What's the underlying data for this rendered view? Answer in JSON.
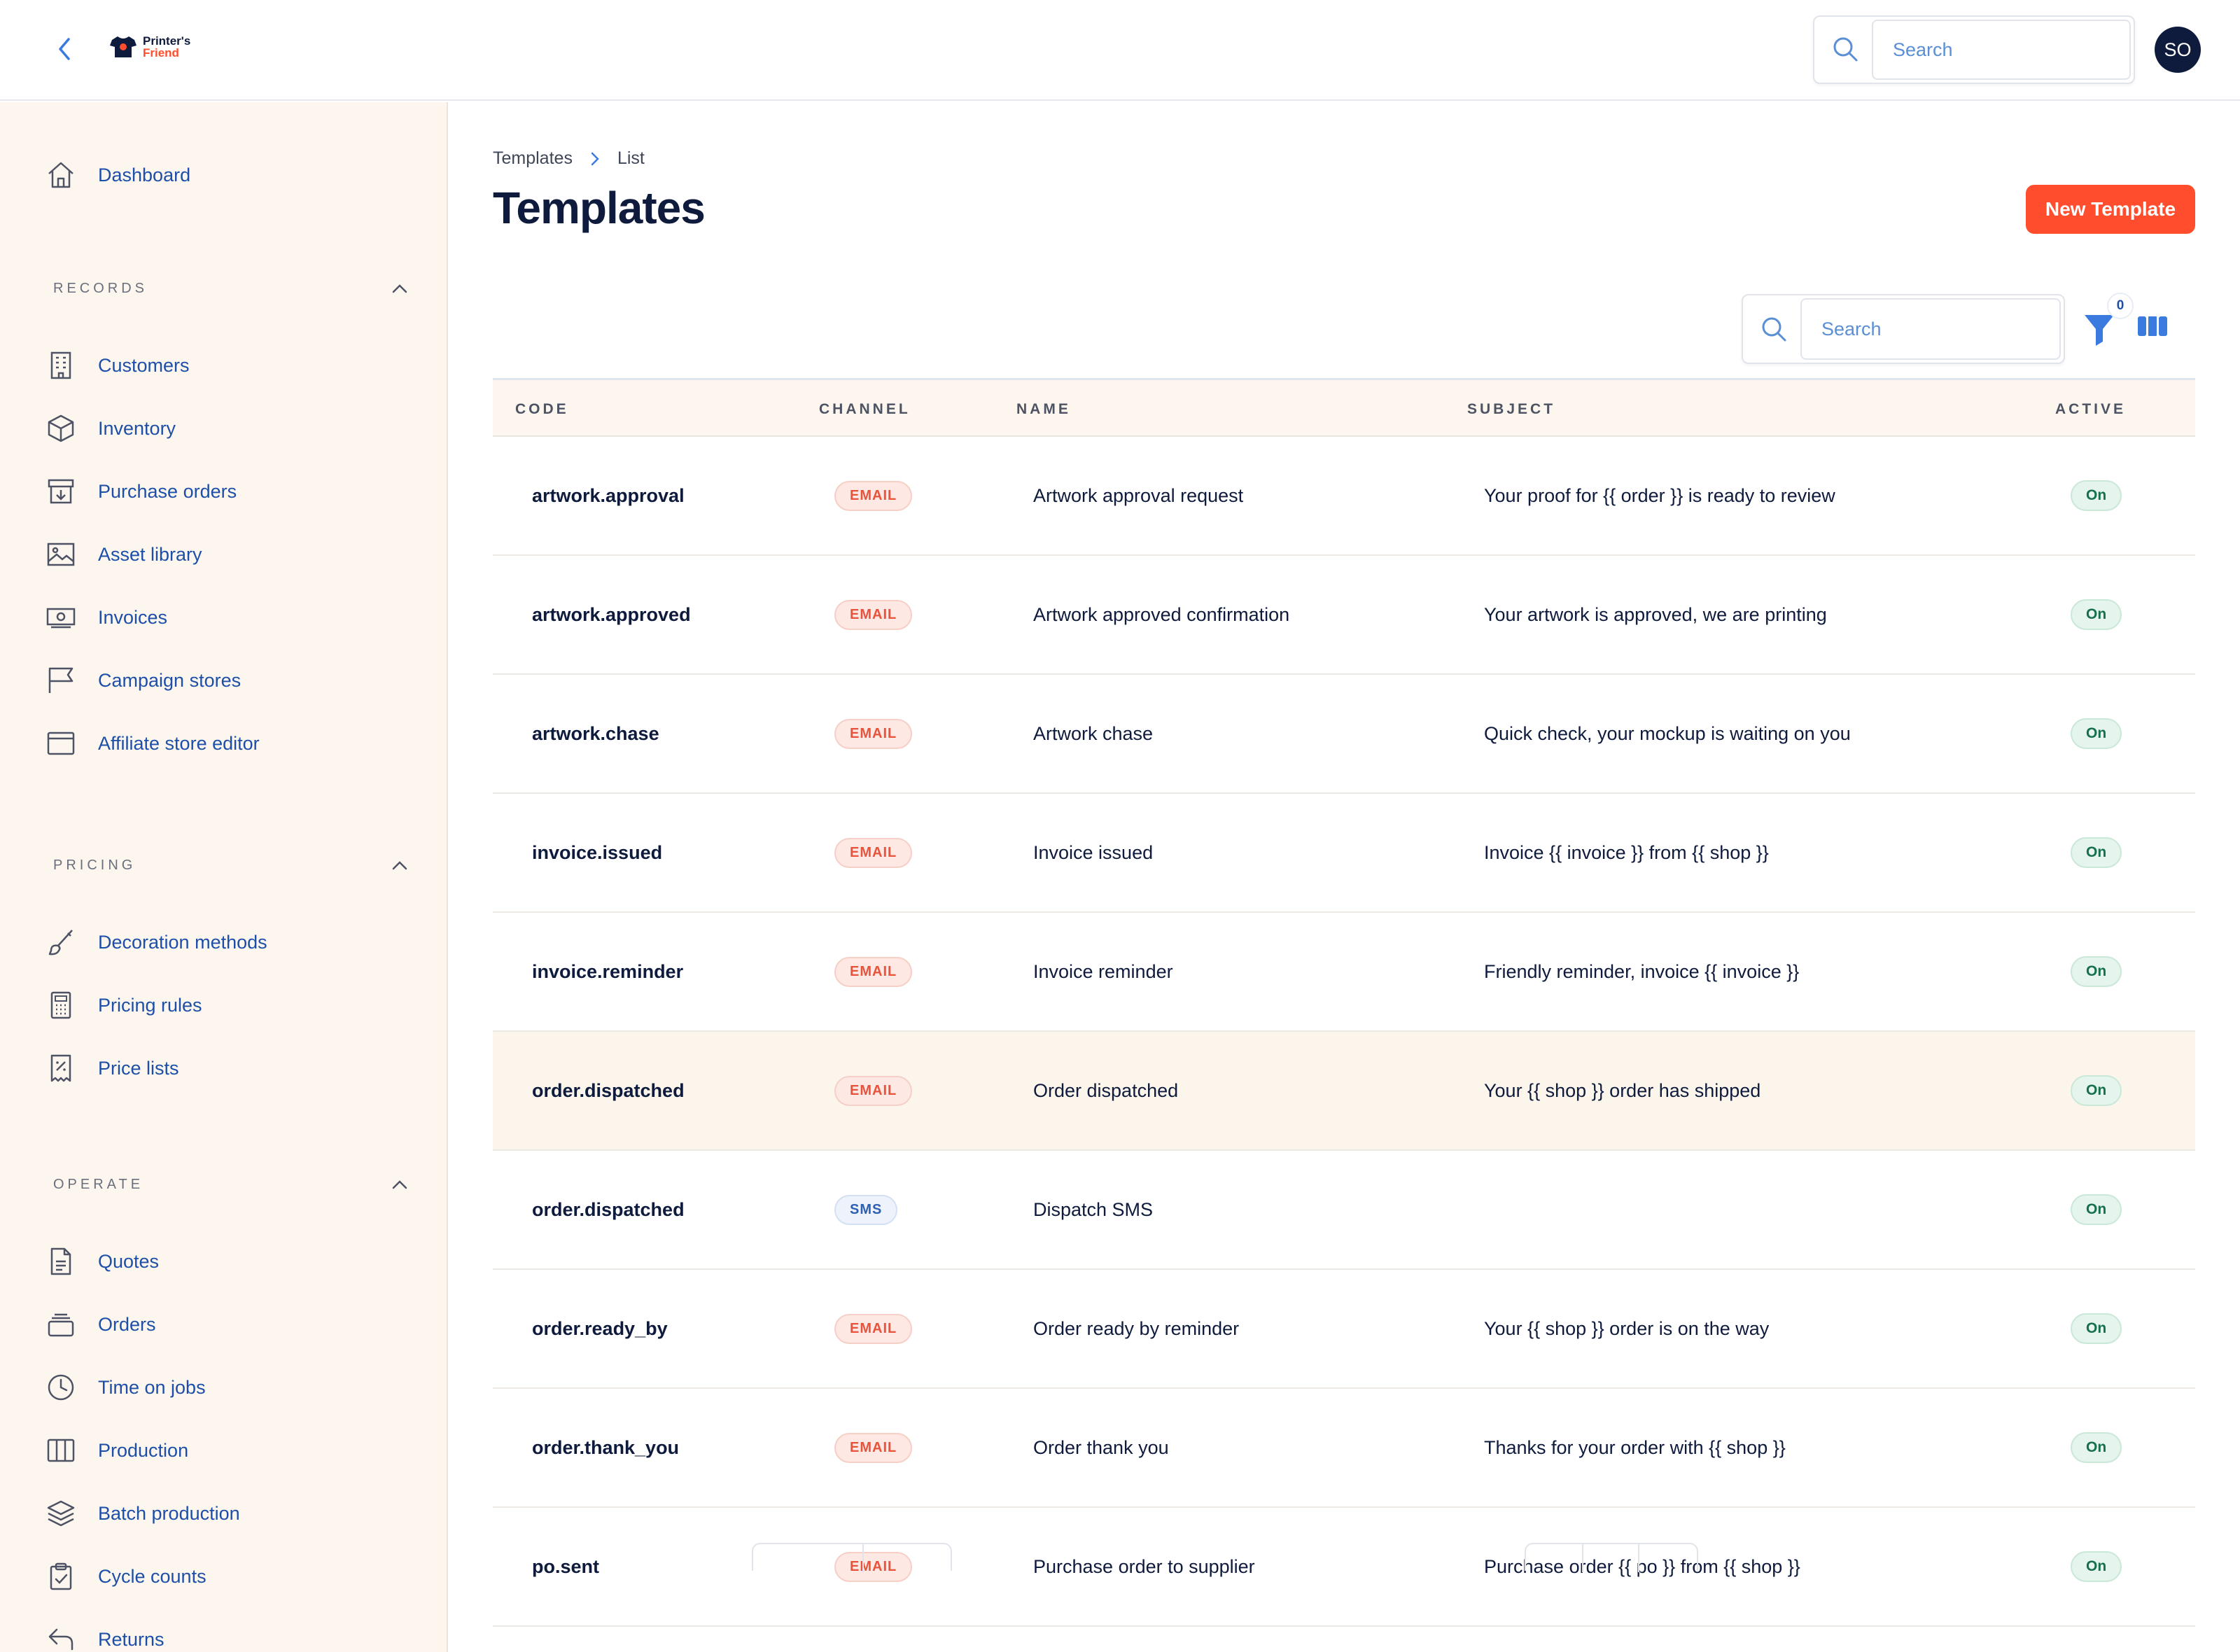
{
  "topbar": {
    "brand_line1": "Printer's",
    "brand_line2": "Friend",
    "search_placeholder": "Search",
    "avatar_initials": "SO"
  },
  "sidebar": {
    "dashboard": "Dashboard",
    "sections": {
      "records": {
        "title": "RECORDS",
        "items": [
          "Customers",
          "Inventory",
          "Purchase orders",
          "Asset library",
          "Invoices",
          "Campaign stores",
          "Affiliate store editor"
        ]
      },
      "pricing": {
        "title": "PRICING",
        "items": [
          "Decoration methods",
          "Pricing rules",
          "Price lists"
        ]
      },
      "operate": {
        "title": "OPERATE",
        "items": [
          "Quotes",
          "Orders",
          "Time on jobs",
          "Production",
          "Batch production",
          "Cycle counts",
          "Returns"
        ]
      }
    }
  },
  "main": {
    "breadcrumb": [
      "Templates",
      "List"
    ],
    "title": "Templates",
    "new_button": "New Template",
    "search_placeholder": "Search",
    "filter_count": "0"
  },
  "table": {
    "headers": [
      "CODE",
      "CHANNEL",
      "NAME",
      "SUBJECT",
      "ACTIVE"
    ],
    "rows": [
      {
        "code": "artwork.approval",
        "channel": "EMAIL",
        "name": "Artwork approval request",
        "subject": "Your proof for {{ order }} is ready to review",
        "active": "On"
      },
      {
        "code": "artwork.approved",
        "channel": "EMAIL",
        "name": "Artwork approved confirmation",
        "subject": "Your artwork is approved, we are printing",
        "active": "On"
      },
      {
        "code": "artwork.chase",
        "channel": "EMAIL",
        "name": "Artwork chase",
        "subject": "Quick check, your mockup is waiting on you",
        "active": "On"
      },
      {
        "code": "invoice.issued",
        "channel": "EMAIL",
        "name": "Invoice issued",
        "subject": "Invoice {{ invoice }} from {{ shop }}",
        "active": "On"
      },
      {
        "code": "invoice.reminder",
        "channel": "EMAIL",
        "name": "Invoice reminder",
        "subject": "Friendly reminder, invoice {{ invoice }}",
        "active": "On"
      },
      {
        "code": "order.dispatched",
        "channel": "EMAIL",
        "name": "Order dispatched",
        "subject": "Your {{ shop }} order has shipped",
        "active": "On"
      },
      {
        "code": "order.dispatched",
        "channel": "SMS",
        "name": "Dispatch SMS",
        "subject": "",
        "active": "On"
      },
      {
        "code": "order.ready_by",
        "channel": "EMAIL",
        "name": "Order ready by reminder",
        "subject": "Your {{ shop }} order is on the way",
        "active": "On"
      },
      {
        "code": "order.thank_you",
        "channel": "EMAIL",
        "name": "Order thank you",
        "subject": "Thanks for your order with {{ shop }}",
        "active": "On"
      },
      {
        "code": "po.sent",
        "channel": "EMAIL",
        "name": "Purchase order to supplier",
        "subject": "Purchase order {{ po }} from {{ shop }}",
        "active": "On"
      }
    ]
  }
}
